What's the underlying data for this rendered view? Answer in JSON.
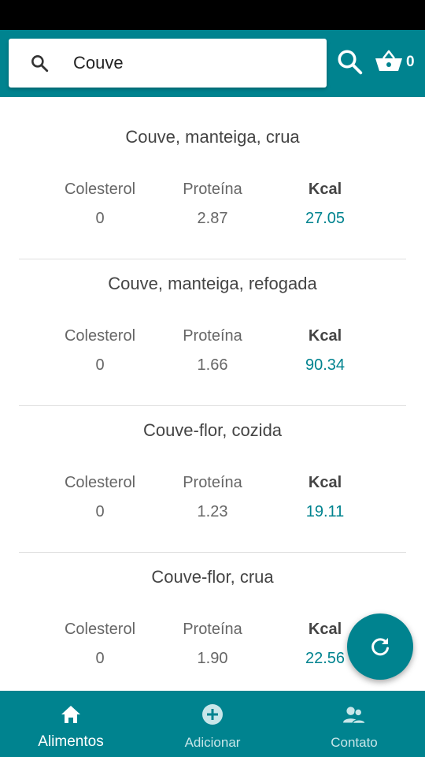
{
  "search": {
    "query": "Couve"
  },
  "cart": {
    "count": "0"
  },
  "foods": [
    {
      "name": "Couve, manteiga, crua",
      "labels": [
        "Colesterol",
        "Proteína",
        "Kcal"
      ],
      "values": [
        "0",
        "2.87",
        "27.05"
      ]
    },
    {
      "name": "Couve, manteiga, refogada",
      "labels": [
        "Colesterol",
        "Proteína",
        "Kcal"
      ],
      "values": [
        "0",
        "1.66",
        "90.34"
      ]
    },
    {
      "name": "Couve-flor, cozida",
      "labels": [
        "Colesterol",
        "Proteína",
        "Kcal"
      ],
      "values": [
        "0",
        "1.23",
        "19.11"
      ]
    },
    {
      "name": "Couve-flor, crua",
      "labels": [
        "Colesterol",
        "Proteína",
        "Kcal"
      ],
      "values": [
        "0",
        "1.90",
        "22.56"
      ]
    }
  ],
  "nav": [
    {
      "label": "Alimentos",
      "icon": "home-icon",
      "active": true
    },
    {
      "label": "Adicionar",
      "icon": "add-circle-icon",
      "active": false
    },
    {
      "label": "Contato",
      "icon": "people-icon",
      "active": false
    }
  ],
  "colors": {
    "primary": "#00838f",
    "accent_text": "#00838f"
  }
}
